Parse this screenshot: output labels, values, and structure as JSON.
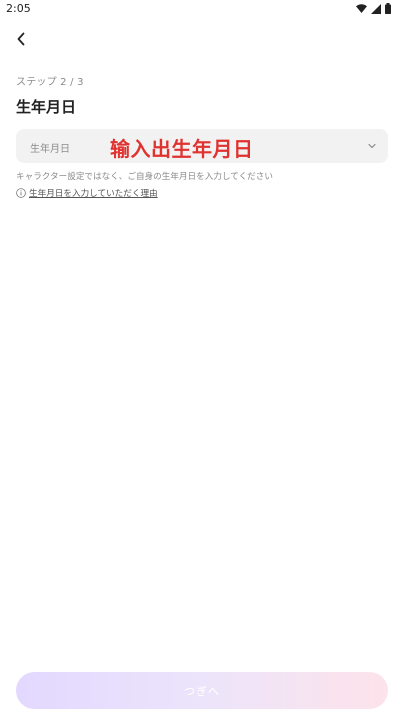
{
  "status_bar": {
    "time": "2:05",
    "icons": [
      "wifi-icon",
      "signal-icon",
      "battery-icon"
    ]
  },
  "header": {
    "back_icon": "chevron-left-icon"
  },
  "step": {
    "label": "ステップ 2 / 3"
  },
  "page": {
    "title": "生年月日"
  },
  "birthday_field": {
    "placeholder": "生年月日",
    "overlay_text": "输入出生年月日",
    "icon": "chevron-down-icon"
  },
  "note": {
    "text": "キャラクター設定ではなく、ご自身の生年月日を入力してください"
  },
  "reason_link": {
    "icon": "info-icon",
    "label": "生年月日を入力していただく理由"
  },
  "footer": {
    "next_label": "つぎへ"
  },
  "colors": {
    "overlay_red": "#e0322f",
    "button_gradient_start": "#e3d8ff",
    "button_gradient_end": "#fde3ea",
    "field_bg": "#f2f2f2"
  }
}
